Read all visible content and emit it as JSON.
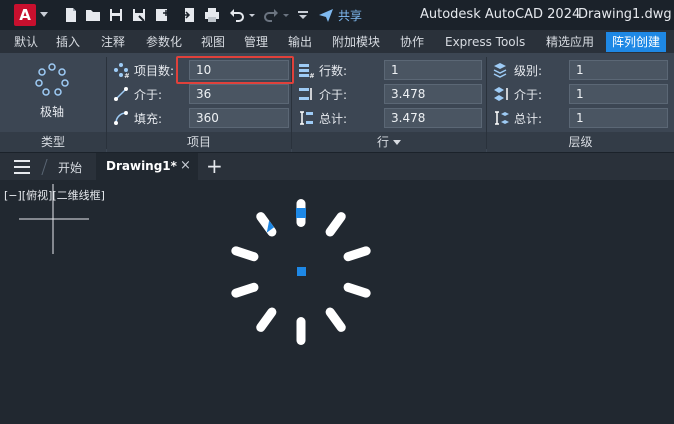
{
  "app": {
    "logo_letter": "A",
    "title": "Autodesk AutoCAD 2024",
    "document": "Drawing1.dwg",
    "share_label": "共享"
  },
  "quick_access": [
    "new-icon",
    "open-icon",
    "save-icon",
    "save-as-icon",
    "publish-icon",
    "print-icon",
    "undo-icon",
    "redo-icon",
    "customize-icon"
  ],
  "ribbon_tabs": [
    {
      "label": "默认",
      "active": false
    },
    {
      "label": "插入",
      "active": false
    },
    {
      "label": "注释",
      "active": false
    },
    {
      "label": "参数化",
      "active": false
    },
    {
      "label": "视图",
      "active": false
    },
    {
      "label": "管理",
      "active": false
    },
    {
      "label": "输出",
      "active": false
    },
    {
      "label": "附加模块",
      "active": false
    },
    {
      "label": "协作",
      "active": false
    },
    {
      "label": "Express Tools",
      "active": false
    },
    {
      "label": "精选应用",
      "active": false
    },
    {
      "label": "阵列创建",
      "active": true
    }
  ],
  "panels": {
    "type": {
      "label": "类型",
      "button": "极轴"
    },
    "items": {
      "label": "项目",
      "count_label": "项目数:",
      "count_value": "10",
      "between_label": "介于:",
      "between_value": "36",
      "fill_label": "填充:",
      "fill_value": "360"
    },
    "rows": {
      "label": "行",
      "rows_label": "行数:",
      "rows_value": "1",
      "between_label": "介于:",
      "between_value": "3.478",
      "total_label": "总计:",
      "total_value": "3.478"
    },
    "levels": {
      "label": "层级",
      "levels_label": "级别:",
      "levels_value": "1",
      "between_label": "介于:",
      "between_value": "1",
      "total_label": "总计:",
      "total_value": "1"
    }
  },
  "file_tabs": {
    "start": "开始",
    "drawing": "Drawing1*",
    "close": "×",
    "add": "+"
  },
  "viewport": {
    "label": "[−][俯视][二维线框]"
  },
  "colors": {
    "accent": "#1e88e5",
    "highlight": "#e0413b",
    "grip": "#1e88e5"
  }
}
